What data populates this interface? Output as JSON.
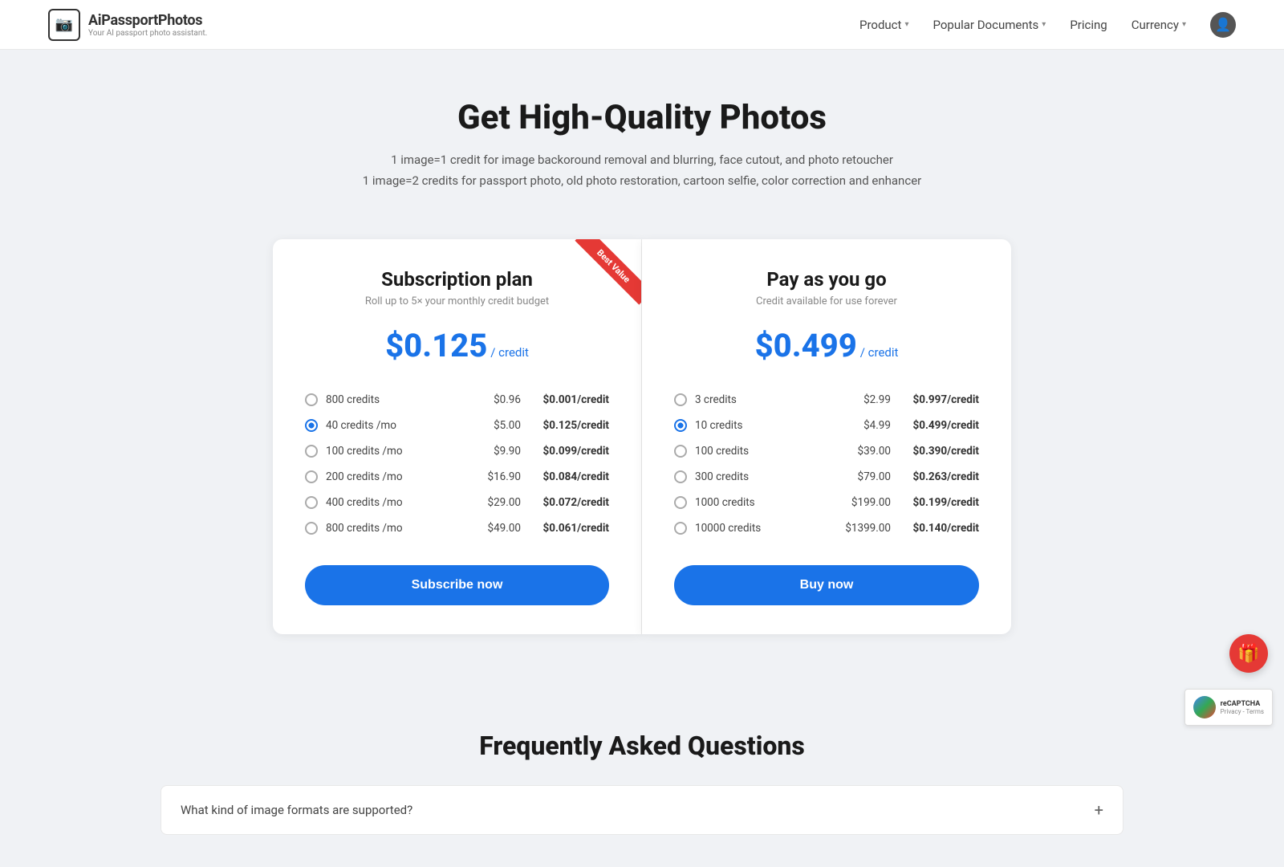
{
  "nav": {
    "logo_title": "AiPassportPhotos",
    "logo_subtitle": "Your AI passport photo assistant.",
    "product_label": "Product",
    "popular_docs_label": "Popular Documents",
    "pricing_label": "Pricing",
    "currency_label": "Currency"
  },
  "hero": {
    "heading": "Get High-Quality Photos",
    "line1": "1 image=1 credit for image backoround removal and blurring, face cutout, and photo retoucher",
    "line2": "1 image=2 credits for passport photo, old photo restoration, cartoon selfie, color correction and enhancer"
  },
  "subscription_card": {
    "title": "Subscription plan",
    "subtitle": "Roll up to 5× your monthly credit budget",
    "price": "$0.125",
    "price_unit": "/ credit",
    "options": [
      {
        "label": "800 credits",
        "price": "$0.96",
        "per_credit": "$0.001/credit",
        "selected": false
      },
      {
        "label": "40 credits /mo",
        "price": "$5.00",
        "per_credit": "$0.125/credit",
        "selected": true
      },
      {
        "label": "100 credits /mo",
        "price": "$9.90",
        "per_credit": "$0.099/credit",
        "selected": false
      },
      {
        "label": "200 credits /mo",
        "price": "$16.90",
        "per_credit": "$0.084/credit",
        "selected": false
      },
      {
        "label": "400 credits /mo",
        "price": "$29.00",
        "per_credit": "$0.072/credit",
        "selected": false
      },
      {
        "label": "800 credits /mo",
        "price": "$49.00",
        "per_credit": "$0.061/credit",
        "selected": false
      }
    ],
    "cta_label": "Subscribe now",
    "best_value": true
  },
  "payg_card": {
    "title": "Pay as you go",
    "subtitle": "Credit available for use forever",
    "price": "$0.499",
    "price_unit": "/ credit",
    "options": [
      {
        "label": "3 credits",
        "price": "$2.99",
        "per_credit": "$0.997/credit",
        "selected": false
      },
      {
        "label": "10 credits",
        "price": "$4.99",
        "per_credit": "$0.499/credit",
        "selected": true
      },
      {
        "label": "100 credits",
        "price": "$39.00",
        "per_credit": "$0.390/credit",
        "selected": false
      },
      {
        "label": "300 credits",
        "price": "$79.00",
        "per_credit": "$0.263/credit",
        "selected": false
      },
      {
        "label": "1000 credits",
        "price": "$199.00",
        "per_credit": "$0.199/credit",
        "selected": false
      },
      {
        "label": "10000 credits",
        "price": "$1399.00",
        "per_credit": "$0.140/credit",
        "selected": false
      }
    ],
    "cta_label": "Buy now"
  },
  "faq": {
    "title": "Frequently Asked Questions",
    "items": [
      {
        "question": "What kind of image formats are supported?"
      }
    ]
  },
  "floating": {
    "gift_icon": "🎁"
  }
}
